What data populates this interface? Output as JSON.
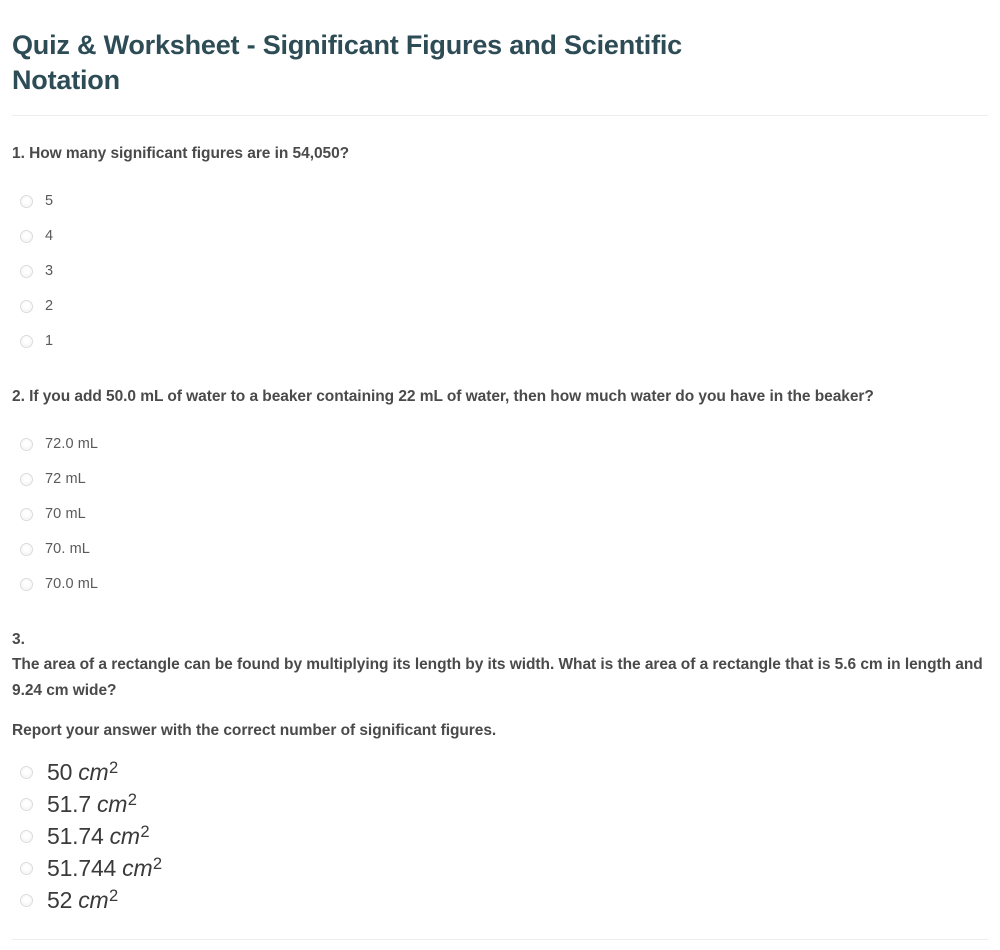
{
  "title": "Quiz & Worksheet - Significant Figures and Scientific Notation",
  "colors": {
    "title": "#2d4c55",
    "question_text": "#4a4a4a",
    "option_text": "#5a5a5a",
    "divider": "#eceef0",
    "background": "#ffffff"
  },
  "questions": [
    {
      "number": "1.",
      "prompt": "1. How many significant figures are in 54,050?",
      "style": "plain",
      "options": [
        {
          "label": "5"
        },
        {
          "label": "4"
        },
        {
          "label": "3"
        },
        {
          "label": "2"
        },
        {
          "label": "1"
        }
      ]
    },
    {
      "number": "2.",
      "prompt": "2. If you add 50.0 mL of water to a beaker containing 22 mL of water, then how much water do you have in the beaker?",
      "style": "plain",
      "options": [
        {
          "label": "72.0 mL"
        },
        {
          "label": "72 mL"
        },
        {
          "label": "70 mL"
        },
        {
          "label": "70. mL"
        },
        {
          "label": "70.0 mL"
        }
      ]
    },
    {
      "number": "3.",
      "prompt": "3.",
      "body": "The area of a rectangle can be found by multiplying its length by its width. What is the area of a rectangle that is 5.6 cm in length and 9.24 cm wide?",
      "sub": "Report your answer with the correct number of significant figures.",
      "style": "math",
      "options": [
        {
          "num": "50",
          "unit": "cm",
          "exp": "2"
        },
        {
          "num": "51.7",
          "unit": "cm",
          "exp": "2"
        },
        {
          "num": "51.74",
          "unit": "cm",
          "exp": "2"
        },
        {
          "num": "51.744",
          "unit": "cm",
          "exp": "2"
        },
        {
          "num": "52",
          "unit": "cm",
          "exp": "2"
        }
      ]
    }
  ]
}
